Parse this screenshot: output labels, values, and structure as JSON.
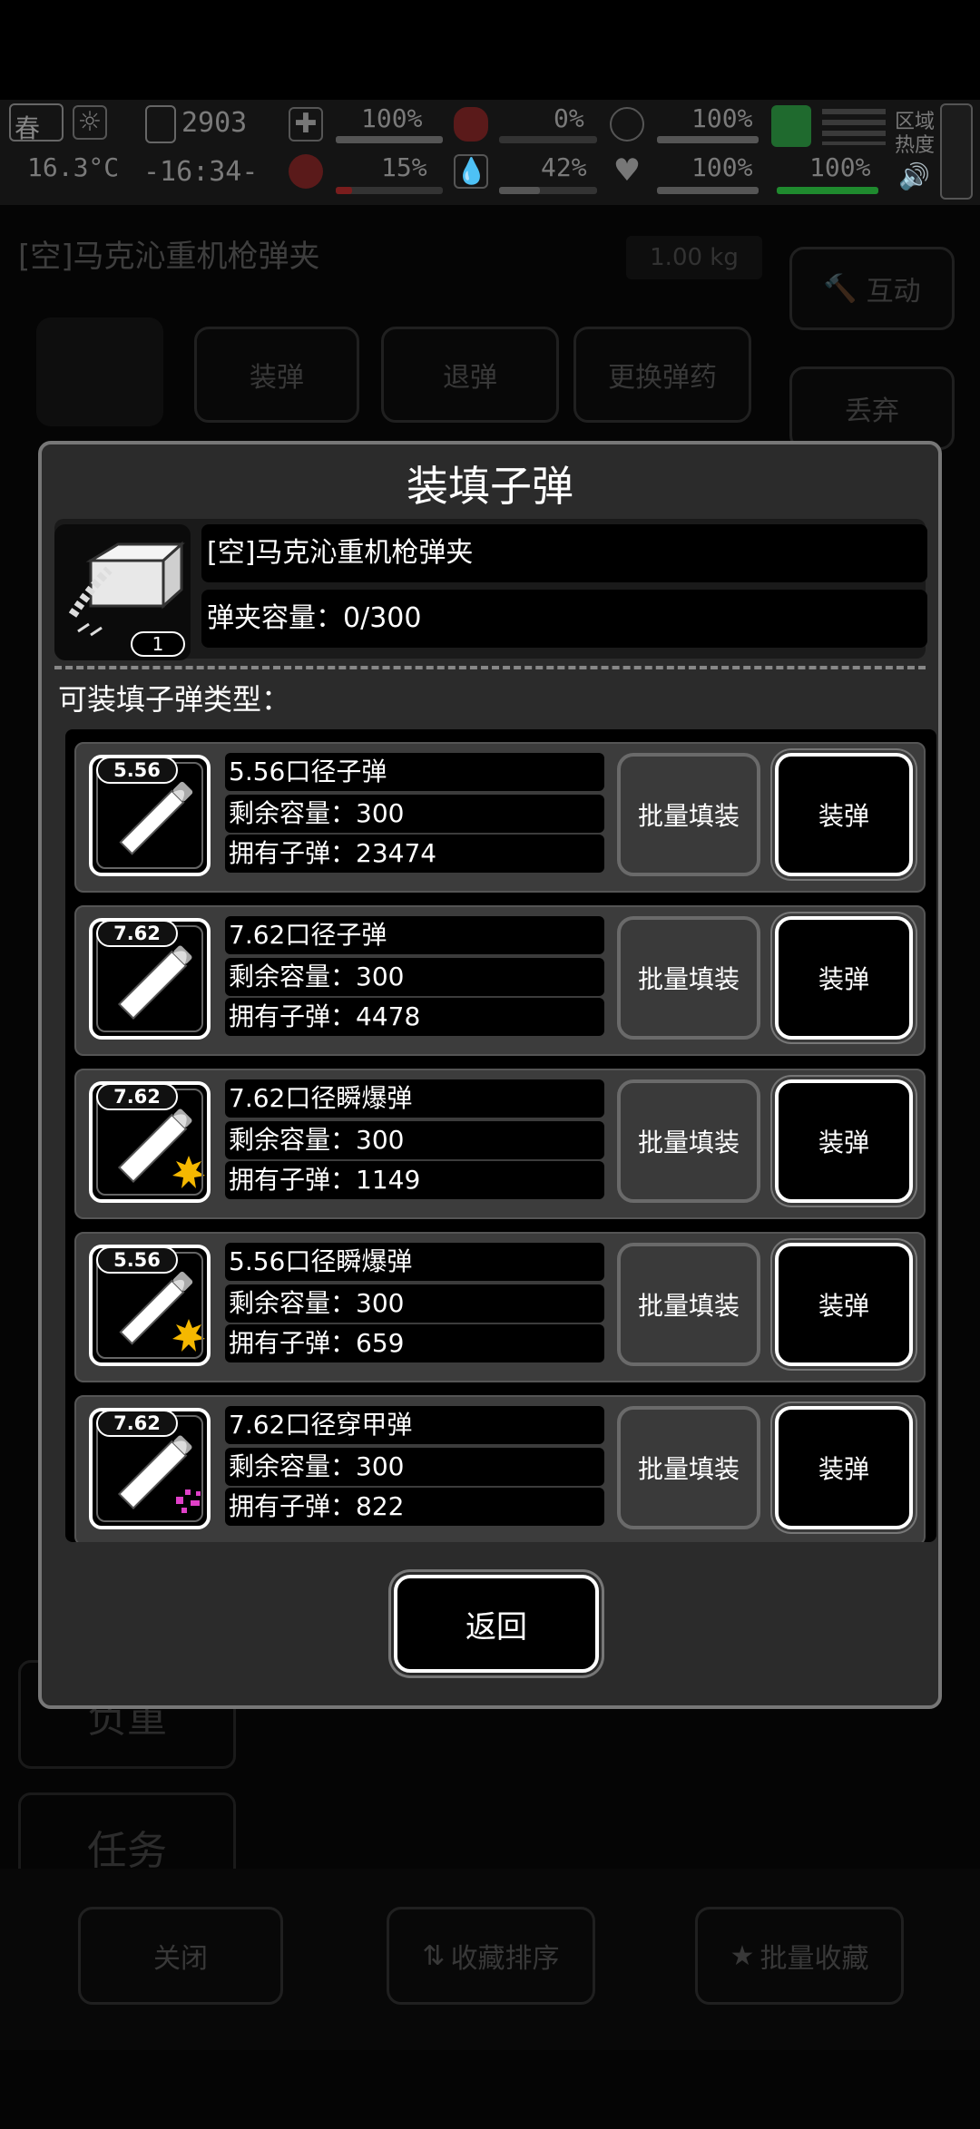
{
  "hud": {
    "season": "春",
    "temperature": "16.3°C",
    "day": "2903",
    "time": "-16:34-",
    "stat1": "100%",
    "stat2": "15%",
    "stat3": "0%",
    "stat4": "42%",
    "stat5": "100%",
    "stat6": "100%",
    "stat7": "100%",
    "region_label": "区域热度",
    "bar_levels": {
      "stat1": 1.0,
      "stat2": 0.15,
      "stat3": 0.0,
      "stat4": 0.42,
      "stat5": 1.0,
      "stat6": 1.0,
      "stat7": 1.0
    }
  },
  "background": {
    "item_title": "[空]马克沁重机枪弹夹",
    "item_weight": "1.00 kg",
    "interact_label": "互动",
    "discard_label": "丢弃",
    "load_tab": "装弹",
    "unload_tab": "退弹",
    "change_ammo_tab": "更换弹药",
    "sidebar_weight": "负重",
    "sidebar_tasks": "任务",
    "footer_close": "关闭",
    "footer_sort": "收藏排序",
    "footer_batch_fav": "批量收藏"
  },
  "modal": {
    "title": "装填子弹",
    "magazine_name": "[空]马克沁重机枪弹夹",
    "magazine_capacity": "弹夹容量：0/300",
    "magazine_count": "1",
    "section_label": "可装填子弹类型：",
    "back_label": "返回"
  },
  "ammo": [
    {
      "caliber": "5.56",
      "name": "5.56口径子弹",
      "remaining": "剩余容量：300",
      "owned": "拥有子弹：23474",
      "bulk_label": "批量填装",
      "load_label": "装弹",
      "effect": "none"
    },
    {
      "caliber": "7.62",
      "name": "7.62口径子弹",
      "remaining": "剩余容量：300",
      "owned": "拥有子弹：4478",
      "bulk_label": "批量填装",
      "load_label": "装弹",
      "effect": "none"
    },
    {
      "caliber": "7.62",
      "name": "7.62口径瞬爆弹",
      "remaining": "剩余容量：300",
      "owned": "拥有子弹：1149",
      "bulk_label": "批量填装",
      "load_label": "装弹",
      "effect": "explosive"
    },
    {
      "caliber": "5.56",
      "name": "5.56口径瞬爆弹",
      "remaining": "剩余容量：300",
      "owned": "拥有子弹：659",
      "bulk_label": "批量填装",
      "load_label": "装弹",
      "effect": "explosive"
    },
    {
      "caliber": "7.62",
      "name": "7.62口径穿甲弹",
      "remaining": "剩余容量：300",
      "owned": "拥有子弹：822",
      "bulk_label": "批量填装",
      "load_label": "装弹",
      "effect": "armor-piercing"
    }
  ],
  "colors": {
    "explosive": "#f5b800",
    "armor_piercing": "#e040c8",
    "hud_green": "#1f8a2e",
    "hud_red": "#7a1d1d"
  }
}
